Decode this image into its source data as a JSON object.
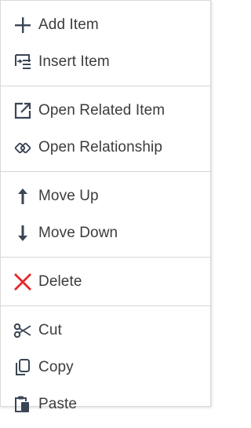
{
  "menu": {
    "groups": [
      {
        "items": [
          {
            "label": "Add Item",
            "icon": "plus-icon"
          },
          {
            "label": "Insert Item",
            "icon": "insert-list-icon"
          }
        ]
      },
      {
        "items": [
          {
            "label": "Open Related Item",
            "icon": "open-external-icon"
          },
          {
            "label": "Open Relationship",
            "icon": "link-rings-icon"
          }
        ]
      },
      {
        "items": [
          {
            "label": "Move Up",
            "icon": "arrow-up-icon"
          },
          {
            "label": "Move Down",
            "icon": "arrow-down-icon"
          }
        ]
      },
      {
        "items": [
          {
            "label": "Delete",
            "icon": "red-x-icon"
          }
        ]
      },
      {
        "items": [
          {
            "label": "Cut",
            "icon": "scissors-icon"
          },
          {
            "label": "Copy",
            "icon": "copy-icon"
          },
          {
            "label": "Paste",
            "icon": "paste-icon"
          }
        ]
      }
    ]
  },
  "colors": {
    "text": "#3c3c3c",
    "icon": "#3a4654",
    "delete": "#e8282c",
    "divider": "#d6d6d6"
  }
}
